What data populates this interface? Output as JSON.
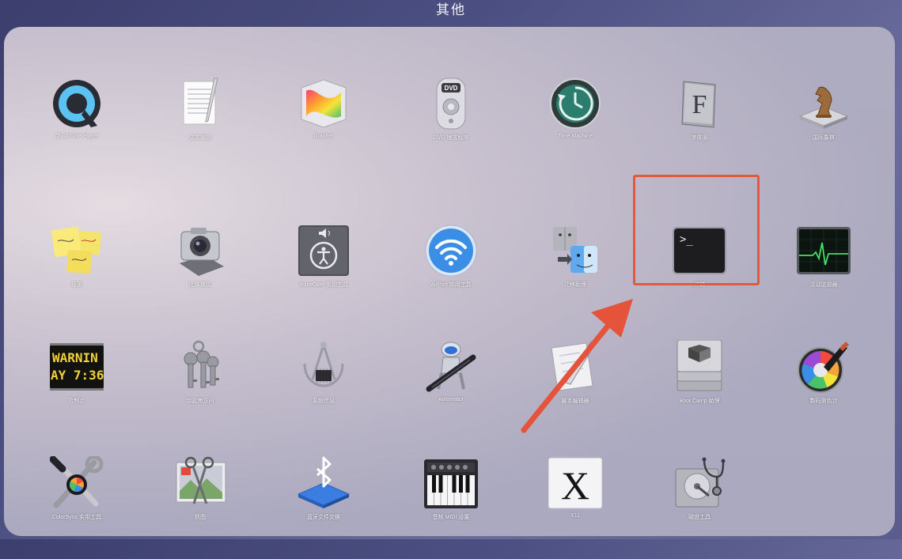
{
  "folder": {
    "title": "其他"
  },
  "apps": [
    {
      "label": "QuickTime Player",
      "icon": "quicktime-icon"
    },
    {
      "label": "文本编辑",
      "icon": "textedit-icon"
    },
    {
      "label": "Grapher",
      "icon": "grapher-icon"
    },
    {
      "label": "DVD 播放程序",
      "icon": "dvd-player-icon"
    },
    {
      "label": "Time Machine",
      "icon": "time-machine-icon"
    },
    {
      "label": "字体册",
      "icon": "font-book-icon"
    },
    {
      "label": "国际象棋",
      "icon": "chess-icon"
    },
    {
      "label": "便笺",
      "icon": "stickies-icon"
    },
    {
      "label": "图像捕捉",
      "icon": "image-capture-icon"
    },
    {
      "label": "VoiceOver 实用工具",
      "icon": "voiceover-icon"
    },
    {
      "label": "AirPort 实用工具",
      "icon": "airport-icon"
    },
    {
      "label": "迁移助理",
      "icon": "migration-assistant-icon"
    },
    {
      "label": "终端",
      "icon": "terminal-icon"
    },
    {
      "label": "活动监视器",
      "icon": "activity-monitor-icon"
    },
    {
      "label": "控制台",
      "icon": "console-icon"
    },
    {
      "label": "钥匙串访问",
      "icon": "keychain-icon"
    },
    {
      "label": "系统信息",
      "icon": "system-information-icon"
    },
    {
      "label": "Automator",
      "icon": "automator-icon"
    },
    {
      "label": "脚本编辑器",
      "icon": "script-editor-icon"
    },
    {
      "label": "Boot Camp 助理",
      "icon": "boot-camp-icon"
    },
    {
      "label": "数码测色计",
      "icon": "color-meter-icon"
    },
    {
      "label": "ColorSync 实用工具",
      "icon": "colorsync-icon"
    },
    {
      "label": "抓图",
      "icon": "grab-icon"
    },
    {
      "label": "蓝牙文件交换",
      "icon": "bluetooth-file-exchange-icon"
    },
    {
      "label": "音频 MIDI 设置",
      "icon": "audio-midi-icon"
    },
    {
      "label": "X11",
      "icon": "x11-icon"
    },
    {
      "label": "磁盘工具",
      "icon": "disk-utility-icon"
    }
  ],
  "console_text": {
    "line1": "WARNIN",
    "line2": "AY 7:36"
  },
  "terminal_prompt": ">_",
  "font_book_letter": "F",
  "x11_letter": "X",
  "dvd_text": "DVD",
  "accent": {
    "highlight": "#e25a3c",
    "arrow": "#e4533a"
  }
}
